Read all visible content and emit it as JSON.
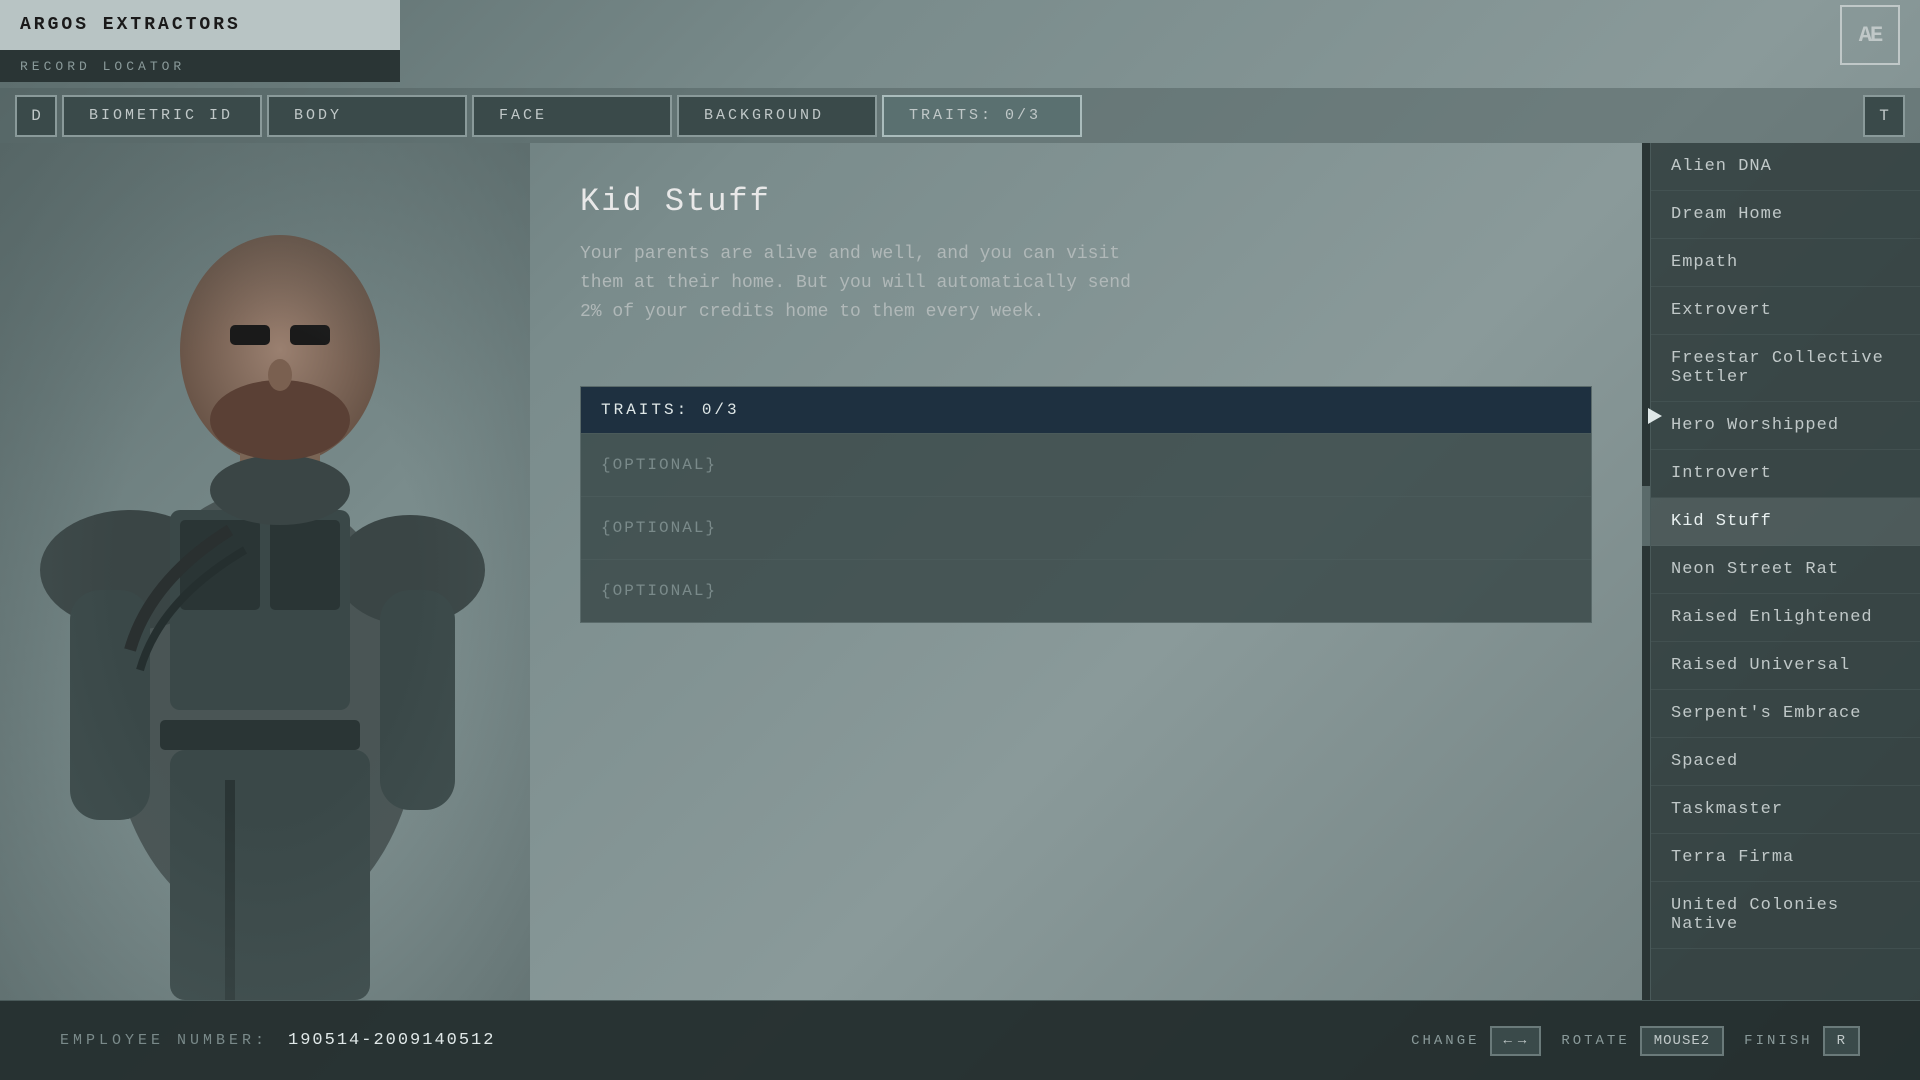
{
  "app": {
    "title": "ARGOS EXTRACTORS",
    "record_locator": "RECORD LOCATOR",
    "logo": "AE"
  },
  "nav": {
    "left_icon": "◁",
    "right_icon": "T",
    "tabs": [
      {
        "id": "biometric",
        "label": "BIOMETRIC ID"
      },
      {
        "id": "body",
        "label": "BODY"
      },
      {
        "id": "face",
        "label": "FACE"
      },
      {
        "id": "background",
        "label": "BACKGROUND"
      },
      {
        "id": "traits",
        "label": "TRAITS: 0/3",
        "active": true
      }
    ]
  },
  "trait_detail": {
    "title": "Kid Stuff",
    "description": "Your parents are alive and well, and you can visit them at their home. But you will automatically send 2% of your credits home to them every week."
  },
  "traits_panel": {
    "header": "TRAITS: 0/3",
    "slots": [
      {
        "label": "{OPTIONAL}"
      },
      {
        "label": "{OPTIONAL}"
      },
      {
        "label": "{OPTIONAL}"
      }
    ]
  },
  "sidebar": {
    "items": [
      {
        "id": "alien-dna",
        "label": "Alien DNA",
        "active": false
      },
      {
        "id": "dream-home",
        "label": "Dream Home",
        "active": false
      },
      {
        "id": "empath",
        "label": "Empath",
        "active": false
      },
      {
        "id": "extrovert",
        "label": "Extrovert",
        "active": false
      },
      {
        "id": "freestar",
        "label": "Freestar Collective Settler",
        "active": false
      },
      {
        "id": "hero-worshipped",
        "label": "Hero Worshipped",
        "active": false
      },
      {
        "id": "introvert",
        "label": "Introvert",
        "active": false
      },
      {
        "id": "kid-stuff",
        "label": "Kid Stuff",
        "active": true
      },
      {
        "id": "neon-street-rat",
        "label": "Neon Street Rat",
        "active": false
      },
      {
        "id": "raised-enlightened",
        "label": "Raised Enlightened",
        "active": false
      },
      {
        "id": "raised-universal",
        "label": "Raised Universal",
        "active": false
      },
      {
        "id": "serpents-embrace",
        "label": "Serpent's Embrace",
        "active": false
      },
      {
        "id": "spaced",
        "label": "Spaced",
        "active": false
      },
      {
        "id": "taskmaster",
        "label": "Taskmaster",
        "active": false
      },
      {
        "id": "terra-firma",
        "label": "Terra Firma",
        "active": false
      },
      {
        "id": "united-colonies-native",
        "label": "United Colonies Native",
        "active": false
      }
    ]
  },
  "bottom": {
    "employee_label": "EMPLOYEE NUMBER:",
    "employee_number": "190514-2009140512",
    "change_label": "CHANGE",
    "change_prev": "←",
    "change_next": "→",
    "rotate_label": "ROTATE",
    "rotate_key": "MOUSE2",
    "finish_label": "FINISH",
    "finish_key": "R"
  }
}
